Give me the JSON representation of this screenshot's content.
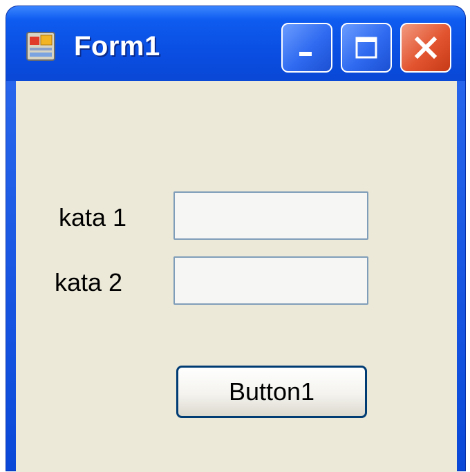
{
  "window": {
    "title": "Form1",
    "icon": "form-app-icon",
    "controls": {
      "minimize_icon": "minimize-icon",
      "maximize_icon": "maximize-icon",
      "close_icon": "close-icon"
    }
  },
  "form": {
    "label1": "kata 1",
    "label2": "kata 2",
    "textbox1_value": "",
    "textbox2_value": "",
    "button_label": "Button1"
  },
  "colors": {
    "titlebar": "#0a4ee2",
    "client_background": "#ece9d8",
    "close_button": "#e2542f",
    "control_button": "#2f6af0"
  }
}
